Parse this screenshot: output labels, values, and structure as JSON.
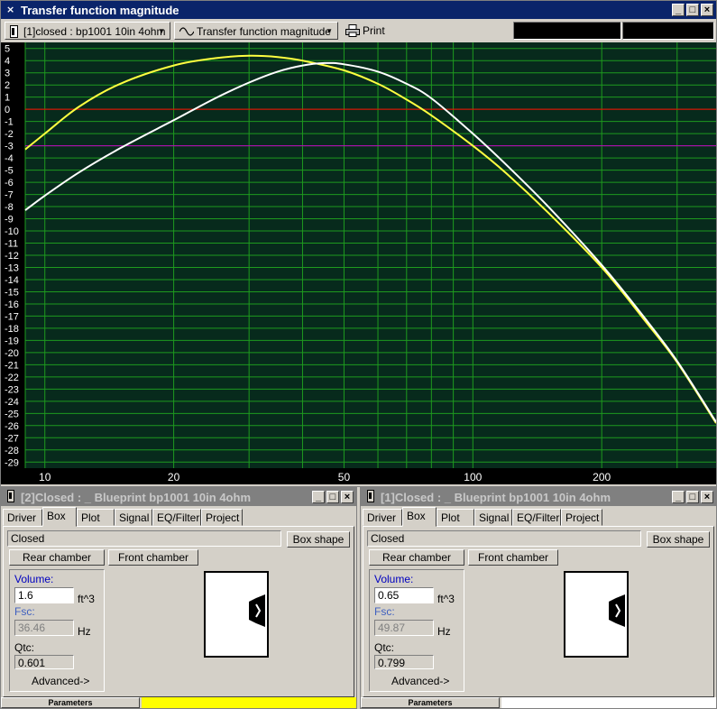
{
  "main_window": {
    "title": "Transfer function magnitude",
    "project_select": "[1]closed : bp1001 10in 4ohm",
    "curve_select": "Transfer function magnitude",
    "print_label": "Print"
  },
  "chart_data": {
    "type": "line",
    "title": "",
    "xlabel": "",
    "ylabel": "",
    "x_scale": "log",
    "xlim": [
      9,
      370
    ],
    "ylim": [
      -29.5,
      5.5
    ],
    "x_ticks": [
      10,
      20,
      50,
      100,
      200
    ],
    "x_tick_labels": [
      "10",
      "20",
      "50",
      "100",
      "200"
    ],
    "y_ticks": [
      5,
      4,
      3,
      2,
      1,
      0,
      -1,
      -2,
      -3,
      -4,
      -5,
      -6,
      -7,
      -8,
      -9,
      -10,
      -11,
      -12,
      -13,
      -14,
      -15,
      -16,
      -17,
      -18,
      -19,
      -20,
      -21,
      -22,
      -23,
      -24,
      -25,
      -26,
      -27,
      -28,
      -29
    ],
    "y_tick_labels": [
      "5",
      "4",
      "3",
      "2",
      "1",
      "0",
      "-1",
      "-2",
      "-3",
      "-4",
      "-5",
      "-6",
      "-7",
      "-8",
      "-9",
      "-10",
      "-11",
      "-12",
      "-13",
      "-14",
      "-15",
      "-16",
      "-17",
      "-18",
      "-19",
      "-20",
      "-21",
      "-22",
      "-23",
      "-24",
      "-25",
      "-26",
      "-27",
      "-28",
      "-29"
    ],
    "grid": true,
    "reference_lines": [
      {
        "y": 0,
        "color": "#ff0000"
      },
      {
        "y": -3,
        "color": "#c000c0"
      }
    ],
    "series": [
      {
        "color": "#ffff40",
        "x": [
          9,
          10,
          12,
          15,
          20,
          25,
          30,
          35,
          40,
          50,
          60,
          70,
          80,
          100,
          120,
          150,
          200,
          250,
          300,
          370
        ],
        "y": [
          -3.3,
          -2.0,
          0.2,
          2.1,
          3.6,
          4.2,
          4.4,
          4.3,
          4.0,
          3.2,
          2.1,
          0.8,
          -0.5,
          -3.0,
          -5.3,
          -8.5,
          -13.0,
          -17.2,
          -20.8,
          -25.8
        ]
      },
      {
        "color": "#ffffff",
        "x": [
          9,
          10,
          12,
          15,
          20,
          25,
          30,
          35,
          40,
          45,
          50,
          60,
          70,
          80,
          100,
          120,
          150,
          200,
          250,
          300,
          370
        ],
        "y": [
          -8.3,
          -7.1,
          -5.2,
          -3.2,
          -0.9,
          0.9,
          2.2,
          3.1,
          3.6,
          3.8,
          3.7,
          3.1,
          2.1,
          0.9,
          -2.0,
          -4.6,
          -8.0,
          -12.8,
          -17.0,
          -20.7,
          -25.7
        ]
      }
    ]
  },
  "panels": [
    {
      "title": "[2]Closed : _ Blueprint bp1001 10in 4ohm",
      "tabs": [
        "Driver",
        "Box",
        "Plot",
        "Signal",
        "EQ/Filter",
        "Project"
      ],
      "box_type": "Closed",
      "box_shape_label": "Box shape",
      "rear_chamber_label": "Rear chamber",
      "front_chamber_label": "Front chamber",
      "volume_label": "Volume:",
      "volume_value": "1.6",
      "volume_unit": "ft^3",
      "fsc_label": "Fsc:",
      "fsc_value": "36.46",
      "fsc_unit": "Hz",
      "qtc_label": "Qtc:",
      "qtc_value": "0.601",
      "advanced_label": "Advanced->",
      "status_label": "Parameters",
      "color": "#ffff00"
    },
    {
      "title": "[1]Closed : _ Blueprint bp1001 10in 4ohm",
      "tabs": [
        "Driver",
        "Box",
        "Plot",
        "Signal",
        "EQ/Filter",
        "Project"
      ],
      "box_type": "Closed",
      "box_shape_label": "Box shape",
      "rear_chamber_label": "Rear chamber",
      "front_chamber_label": "Front chamber",
      "volume_label": "Volume:",
      "volume_value": "0.65",
      "volume_unit": "ft^3",
      "fsc_label": "Fsc:",
      "fsc_value": "49.87",
      "fsc_unit": "Hz",
      "qtc_label": "Qtc:",
      "qtc_value": "0.799",
      "advanced_label": "Advanced->",
      "status_label": "Parameters",
      "color": "#ffffff"
    }
  ]
}
